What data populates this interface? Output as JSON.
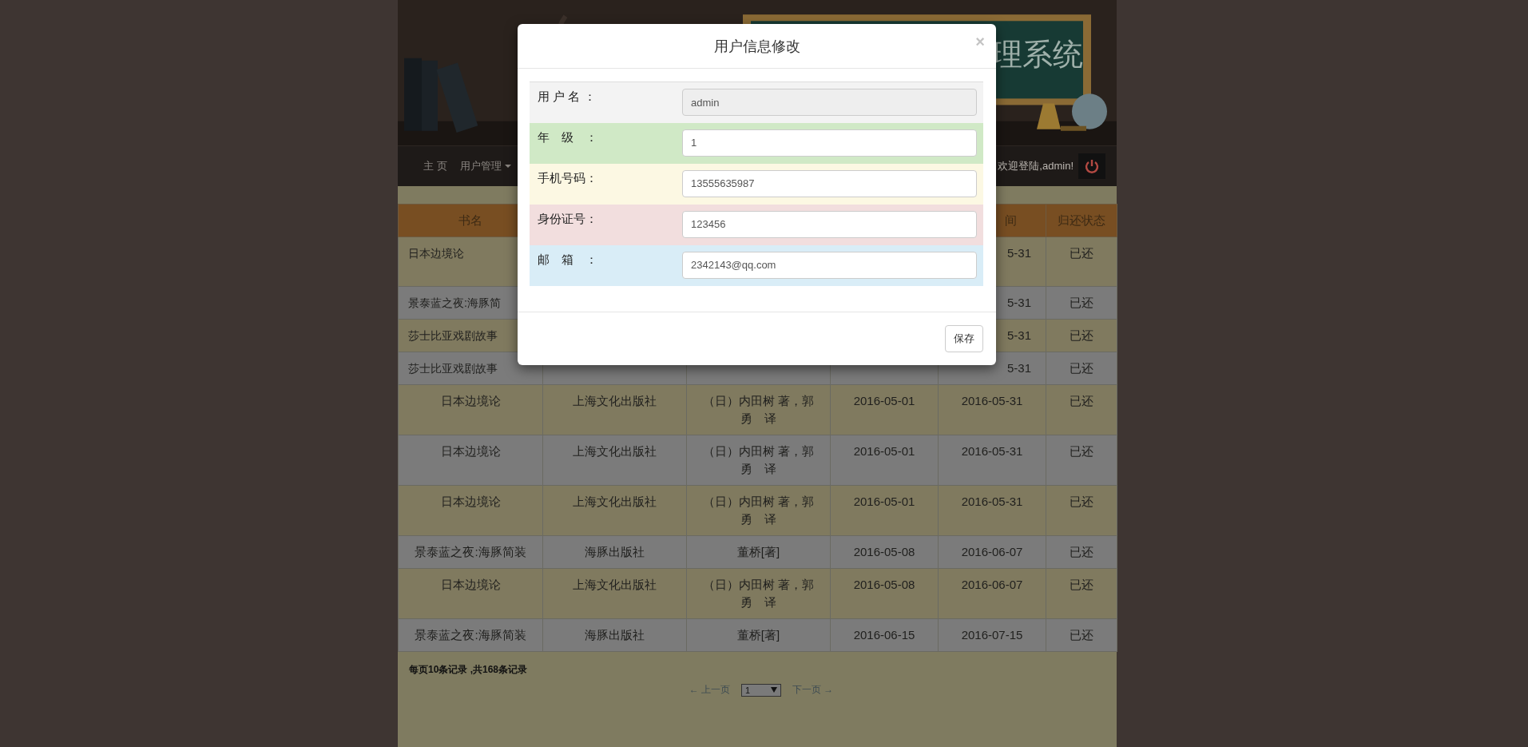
{
  "banner": {
    "kind": "picture",
    "title": "理系统"
  },
  "nav": {
    "items": [
      {
        "label": "主 页",
        "dropdown": false
      },
      {
        "label": "用户管理",
        "dropdown": true
      }
    ],
    "welcome": "欢迎登陆,admin!"
  },
  "table": {
    "header": {
      "title": "书名",
      "return_date": "间",
      "status": "归还状态"
    },
    "rows": [
      {
        "title": "日本边境论",
        "return_date": "5-31",
        "status": "已还"
      },
      {
        "title": "景泰蓝之夜:海豚简",
        "return_date": "5-31",
        "status": "已还"
      },
      {
        "title": "莎士比亚戏剧故事",
        "return_date": "5-31",
        "status": "已还"
      },
      {
        "title": "莎士比亚戏剧故事",
        "return_date": "5-31",
        "status": "已还"
      },
      {
        "title": "日本边境论",
        "publisher": "上海文化出版社",
        "author": "（日）内田树 著，郭勇　译",
        "borrow_date": "2016-05-01",
        "return_date": "2016-05-31",
        "status": "已还"
      },
      {
        "title": "日本边境论",
        "publisher": "上海文化出版社",
        "author": "（日）内田树 著，郭勇　译",
        "borrow_date": "2016-05-01",
        "return_date": "2016-05-31",
        "status": "已还"
      },
      {
        "title": "日本边境论",
        "publisher": "上海文化出版社",
        "author": "（日）内田树 著，郭勇　译",
        "borrow_date": "2016-05-01",
        "return_date": "2016-05-31",
        "status": "已还"
      },
      {
        "title": "景泰蓝之夜:海豚简装",
        "publisher": "海豚出版社",
        "author": "董桥[著]",
        "borrow_date": "2016-05-08",
        "return_date": "2016-06-07",
        "status": "已还"
      },
      {
        "title": "日本边境论",
        "publisher": "上海文化出版社",
        "author": "（日）内田树 著，郭勇　译",
        "borrow_date": "2016-05-08",
        "return_date": "2016-06-07",
        "status": "已还"
      },
      {
        "title": "景泰蓝之夜:海豚简装",
        "publisher": "海豚出版社",
        "author": "董桥[著]",
        "borrow_date": "2016-06-15",
        "return_date": "2016-07-15",
        "status": "已还"
      }
    ]
  },
  "summary": "每页10条记录 ,共168条记录",
  "pagination": {
    "prev": "← 上一页",
    "page": "1",
    "next": "下一页 →"
  },
  "modal": {
    "title": "用户信息修改",
    "close": "×",
    "fields": [
      {
        "label": "用 户 名 ：",
        "value": "admin",
        "disabled": true,
        "color": "#f3f3f3"
      },
      {
        "label": "年　级　：",
        "value": "1",
        "disabled": false,
        "color": "#d0e9c6"
      },
      {
        "label": "手机号码：",
        "value": "13555635987",
        "disabled": false,
        "color": "#fcf8e3"
      },
      {
        "label": "身份证号：",
        "value": "123456",
        "disabled": false,
        "color": "#f2dede"
      },
      {
        "label": "邮　箱　：",
        "value": "2342143@qq.com",
        "disabled": false,
        "color": "#d9edf7"
      }
    ],
    "save": "保存"
  }
}
